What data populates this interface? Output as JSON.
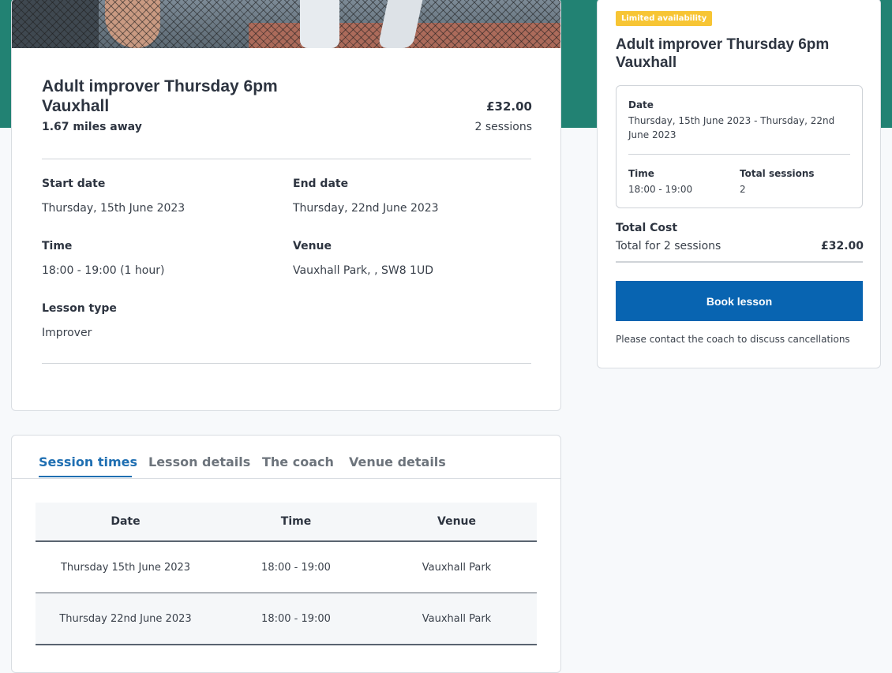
{
  "lesson": {
    "title": "Adult improver Thursday 6pm Vauxhall",
    "distance": "1.67 miles away",
    "price": "£32.00",
    "sessions": "2 sessions",
    "start_date_label": "Start date",
    "start_date": "Thursday, 15th June 2023",
    "end_date_label": "End date",
    "end_date": "Thursday, 22nd June 2023",
    "time_label": "Time",
    "time": "18:00 - 19:00 (1 hour)",
    "venue_label": "Venue",
    "venue": "Vauxhall Park, , SW8 1UD",
    "lesson_type_label": "Lesson type",
    "lesson_type": "Improver"
  },
  "tabs": [
    {
      "label": "Session times",
      "active": true
    },
    {
      "label": "Lesson details",
      "active": false
    },
    {
      "label": "The coach",
      "active": false
    },
    {
      "label": "Venue details",
      "active": false
    }
  ],
  "session_table": {
    "headers": [
      "Date",
      "Time",
      "Venue"
    ],
    "rows": [
      [
        "Thursday 15th June 2023",
        "18:00 - 19:00",
        "Vauxhall Park"
      ],
      [
        "Thursday 22nd June 2023",
        "18:00 - 19:00",
        "Vauxhall Park"
      ]
    ]
  },
  "summary": {
    "badge": "Limited availability",
    "title": "Adult improver Thursday 6pm Vauxhall",
    "date_label": "Date",
    "date_value": "Thursday, 15th June 2023 - Thursday, 22nd June 2023",
    "time_label": "Time",
    "time_value": "18:00 - 19:00",
    "total_sessions_label": "Total sessions",
    "total_sessions_value": "2",
    "total_cost_label": "Total Cost",
    "total_for": "Total for 2 sessions",
    "total_amount": "£32.00",
    "book_button": "Book lesson",
    "cancellation_note": "Please contact the coach to discuss cancellations"
  },
  "colors": {
    "header_band": "#228273",
    "primary_button": "#0864b1",
    "active_tab": "#1f6fb2",
    "badge": "#f7c534"
  }
}
